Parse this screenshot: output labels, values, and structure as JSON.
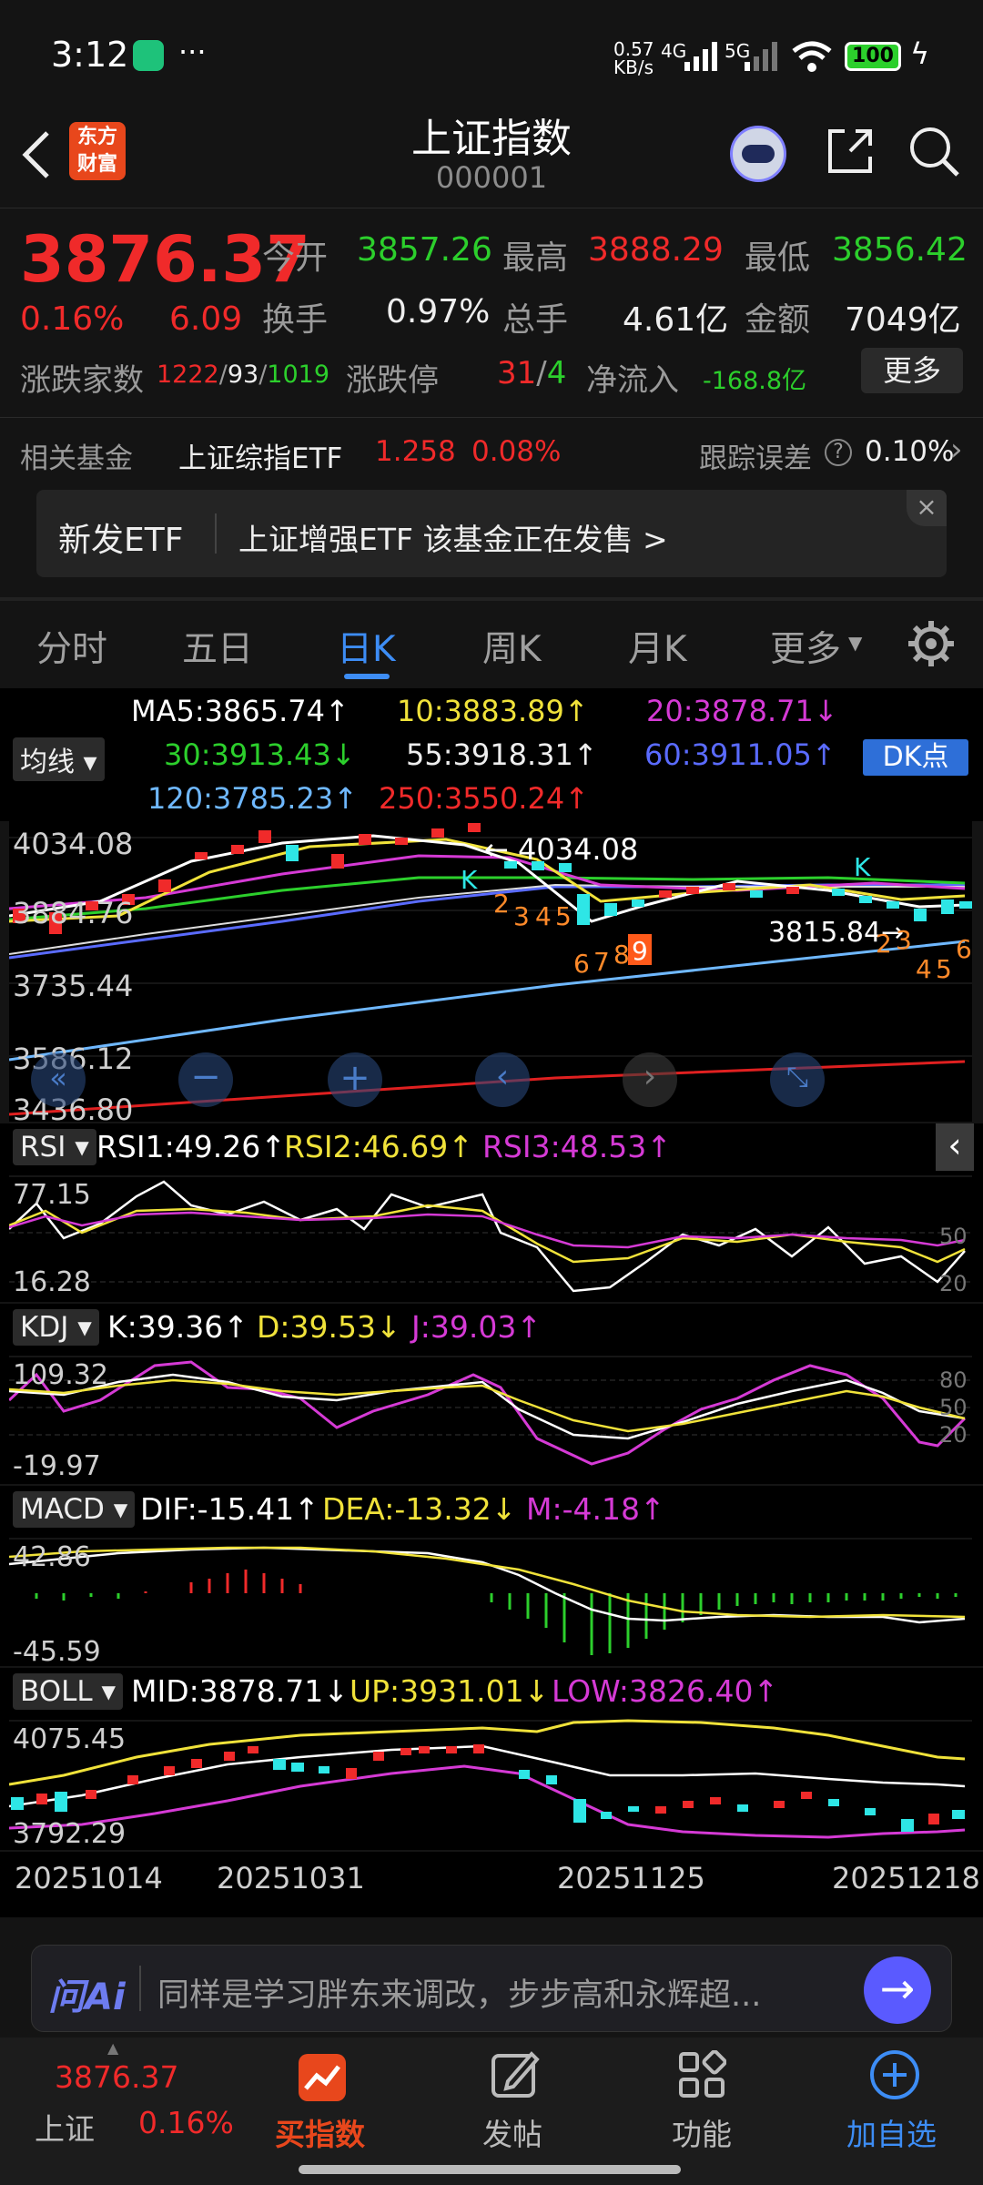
{
  "status": {
    "time": "3:12",
    "net_speed": "0.57\nKB/s",
    "net1": "4G",
    "net2": "5G",
    "battery": "100",
    "dots": "···"
  },
  "nav": {
    "title": "上证指数",
    "code": "000001",
    "logo_top": "东方",
    "logo_bottom": "财富"
  },
  "quote": {
    "price": "3876.37",
    "pct": "0.16%",
    "chg": "6.09",
    "open_label": "今开",
    "open": "3857.26",
    "high_label": "最高",
    "high": "3888.29",
    "low_label": "最低",
    "low": "3856.42",
    "turnover_label": "换手",
    "turnover": "0.97%",
    "volume_label": "总手",
    "volume": "4.61亿",
    "amount_label": "金额",
    "amount": "7049亿",
    "updown_label": "涨跌家数",
    "up": "1222",
    "flat": "93",
    "down": "1019",
    "limit_label": "涨跌停",
    "limit_up": "31",
    "limit_down": "4",
    "inflow_label": "净流入",
    "inflow": "-168.8亿",
    "more": "更多"
  },
  "fund": {
    "label": "相关基金",
    "name": "上证综指ETF",
    "price": "1.258",
    "pct": "0.08%",
    "track_label": "跟踪误差",
    "track": "0.10%"
  },
  "banner": {
    "tag": "新发ETF",
    "text": "上证增强ETF 该基金正在发售  >"
  },
  "tabs": [
    "分时",
    "五日",
    "日K",
    "周K",
    "月K",
    "更多"
  ],
  "ma": {
    "ma5": "MA5:3865.74↑",
    "ma10": "10:3883.89↑",
    "ma20": "20:3878.71↓",
    "ma30": "30:3913.43↓",
    "ma55": "55:3918.31↑",
    "ma60": "60:3911.05↑",
    "ma120": "120:3785.23↑",
    "ma250": "250:3550.24↑",
    "selector": "均线",
    "dk": "DK点"
  },
  "main_axis": [
    "4034.08",
    "3884.76",
    "3735.44",
    "3586.12",
    "3436.80"
  ],
  "annotations": {
    "high": "← 4034.08",
    "low": "3815.84→",
    "k1": "K",
    "k2": "K",
    "n1": "2",
    "n2": "3",
    "n3": "4",
    "n4": "5",
    "n5": "6",
    "n6": "7",
    "n7": "8",
    "n8": "9",
    "m1": "2",
    "m2": "3",
    "m3": "4",
    "m4": "5",
    "m5": "6"
  },
  "rsi": {
    "sel": "RSI",
    "r1": "RSI1:49.26↑",
    "r2": "RSI2:46.69↑",
    "r3": "RSI3:48.53↑",
    "top": "77.15",
    "bot": "16.28",
    "l50": "50",
    "l20": "20"
  },
  "kdj": {
    "sel": "KDJ",
    "k": "K:39.36↑",
    "d": "D:39.53↓",
    "j": "J:39.03↑",
    "top": "109.32",
    "bot": "-19.97",
    "l80": "80",
    "l50": "50",
    "l20": "20"
  },
  "macd": {
    "sel": "MACD",
    "dif": "DIF:-15.41↑",
    "dea": "DEA:-13.32↓",
    "m": "M:-4.18↑",
    "top": "42.86",
    "bot": "-45.59"
  },
  "boll": {
    "sel": "BOLL",
    "mid": "MID:3878.71↓",
    "up": "UP:3931.01↓",
    "low": "LOW:3826.40↑",
    "top": "4075.45",
    "bot": "3792.29"
  },
  "dates": [
    "20251014",
    "20251031",
    "20251125",
    "20251218"
  ],
  "ai": {
    "label": "问Ai",
    "text": "同样是学习胖东来调改，步步高和永辉超..."
  },
  "bottom": {
    "index_price": "3876.37",
    "index_name": "上证",
    "index_pct": "0.16%",
    "buy": "买指数",
    "post": "发帖",
    "func": "功能",
    "add": "加自选"
  },
  "colors": {
    "up": "#f02a2a",
    "down": "#2ccf2c",
    "accent": "#3a7bd5",
    "candle_down": "#2ee6e6"
  }
}
